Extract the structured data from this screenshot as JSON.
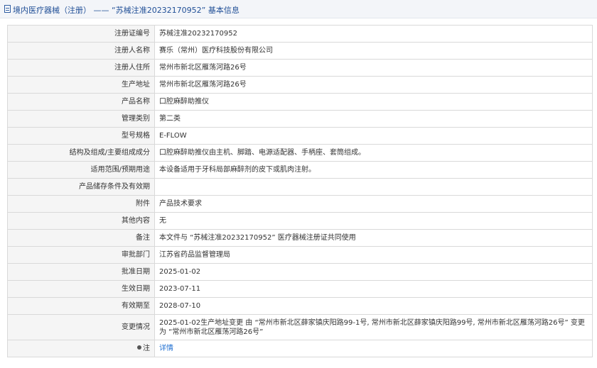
{
  "header": {
    "title": "境内医疗器械（注册） —— “苏械注准20232170952” 基本信息"
  },
  "rows": [
    {
      "label": "注册证编号",
      "value": "苏械注准20232170952"
    },
    {
      "label": "注册人名称",
      "value": "赛乐（常州）医疗科技股份有限公司"
    },
    {
      "label": "注册人住所",
      "value": "常州市新北区雁荡河路26号"
    },
    {
      "label": "生产地址",
      "value": "常州市新北区雁荡河路26号"
    },
    {
      "label": "产品名称",
      "value": "口腔麻醉助推仪"
    },
    {
      "label": "管理类别",
      "value": "第二类"
    },
    {
      "label": "型号规格",
      "value": "E-FLOW"
    },
    {
      "label": "结构及组成/主要组成成分",
      "value": "口腔麻醉助推仪由主机、脚踏、电源适配器、手柄座、套筒组成。"
    },
    {
      "label": "适用范围/预期用途",
      "value": "本设备适用于牙科局部麻醉剂的皮下或肌肉注射。"
    },
    {
      "label": "产品储存条件及有效期",
      "value": ""
    },
    {
      "label": "附件",
      "value": "产品技术要求"
    },
    {
      "label": "其他内容",
      "value": "无"
    },
    {
      "label": "备注",
      "value": "本文件与 “苏械注准20232170952” 医疗器械注册证共同使用"
    },
    {
      "label": "审批部门",
      "value": "江苏省药品监督管理局"
    },
    {
      "label": "批准日期",
      "value": "2025-01-02"
    },
    {
      "label": "生效日期",
      "value": "2023-07-11"
    },
    {
      "label": "有效期至",
      "value": "2028-07-10"
    },
    {
      "label": "变更情况",
      "value": "2025-01-02生产地址变更 由 “常州市新北区薛家镇庆阳路99-1号, 常州市新北区薛家镇庆阳路99号, 常州市新北区雁荡河路26号” 变更为 “常州市新北区雁荡河路26号”"
    }
  ],
  "note": {
    "label": "注",
    "link_text": "详情",
    "icon": "note-icon"
  },
  "colors": {
    "header_bg": "#f3f5f9",
    "title": "#1f4e96",
    "label_bg": "#f5f5f5",
    "border": "#d9d9d9",
    "link": "#1f6fd1"
  }
}
